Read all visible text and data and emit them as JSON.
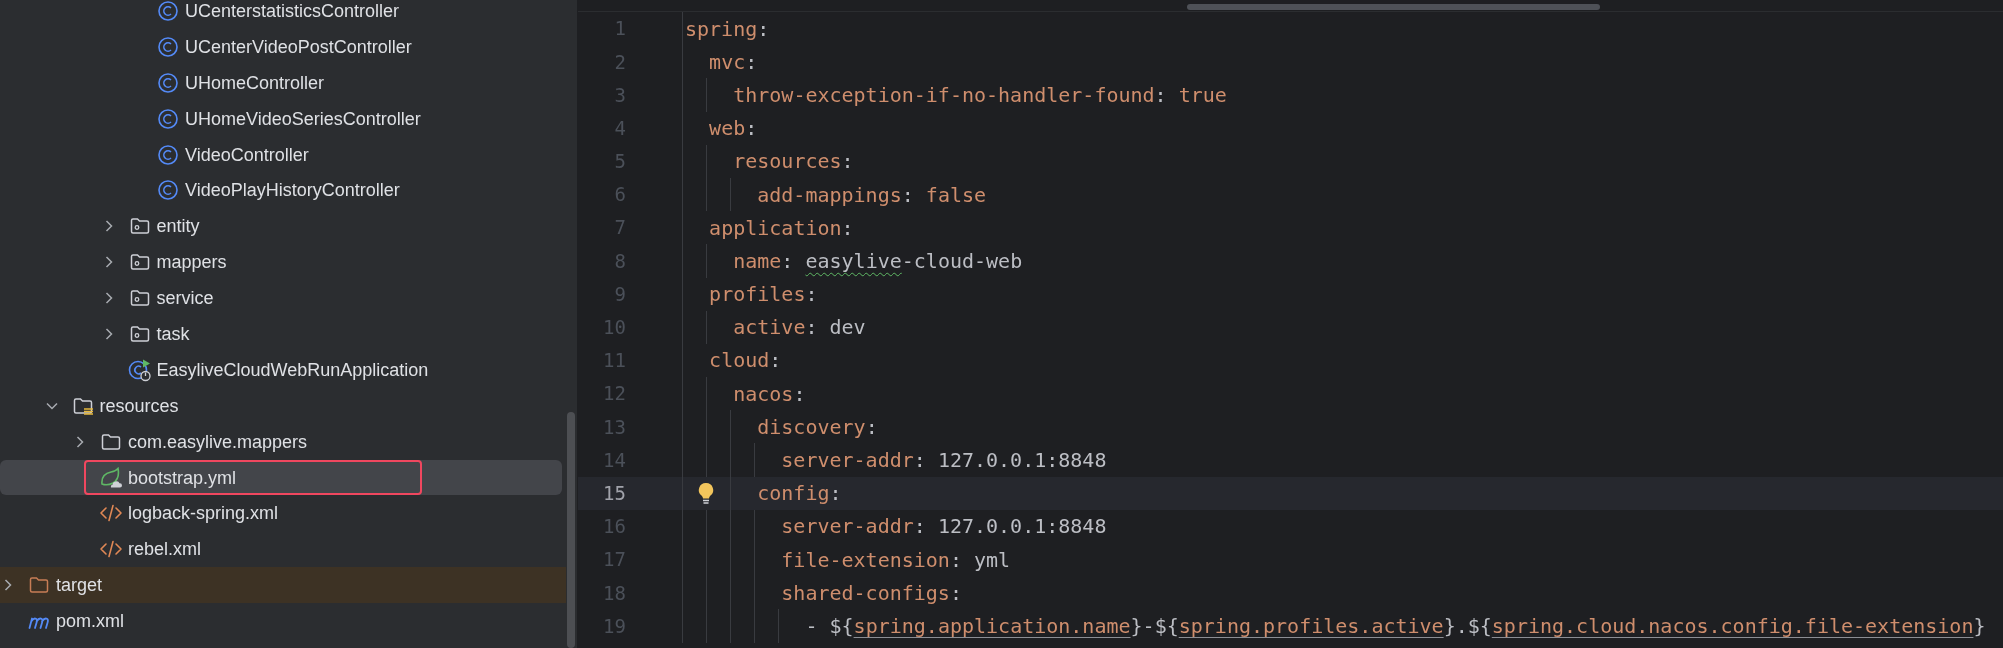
{
  "project_tree": [
    {
      "children": [
        {
          "children": [
            {
              "children": [
                {
                  "children": [
                    {
                      "children": [
                        {
                          "label": "UCenterstatisticsController",
                          "kind": "class",
                          "selected": false,
                          "outlined": false
                        },
                        {
                          "label": "UCenterVideoPostController",
                          "kind": "class",
                          "selected": false,
                          "outlined": false
                        },
                        {
                          "label": "UHomeController",
                          "kind": "class",
                          "selected": false,
                          "outlined": false
                        },
                        {
                          "label": "UHomeVideoSeriesController",
                          "kind": "class",
                          "selected": false,
                          "outlined": false
                        },
                        {
                          "label": "VideoController",
                          "kind": "class",
                          "selected": false,
                          "outlined": false
                        },
                        {
                          "label": "VideoPlayHistoryController",
                          "kind": "class",
                          "selected": false,
                          "outlined": false
                        }
                      ]
                    },
                    {
                      "label": "entity",
                      "kind": "package",
                      "expanded": false,
                      "selected": false,
                      "outlined": false
                    },
                    {
                      "label": "mappers",
                      "kind": "package",
                      "expanded": false,
                      "selected": false,
                      "outlined": false
                    },
                    {
                      "label": "service",
                      "kind": "package",
                      "expanded": false,
                      "selected": false,
                      "outlined": false
                    },
                    {
                      "label": "task",
                      "kind": "package",
                      "expanded": false,
                      "selected": false,
                      "outlined": false
                    },
                    {
                      "label": "EasyliveCloudWebRunApplication",
                      "kind": "run-class",
                      "selected": false,
                      "outlined": false
                    }
                  ]
                }
              ]
            },
            {
              "label": "resources",
              "kind": "resources-folder",
              "expanded": true,
              "selected": false,
              "outlined": false,
              "children": [
                {
                  "label": "com.easylive.mappers",
                  "kind": "folder",
                  "expanded": false,
                  "selected": false,
                  "outlined": false
                },
                {
                  "label": "bootstrap.yml",
                  "kind": "spring-config",
                  "selected": true,
                  "outlined": true
                },
                {
                  "label": "logback-spring.xml",
                  "kind": "xml",
                  "selected": false,
                  "outlined": false
                },
                {
                  "label": "rebel.xml",
                  "kind": "xml",
                  "selected": false,
                  "outlined": false
                }
              ]
            }
          ]
        }
      ]
    },
    {
      "label": "target",
      "kind": "excluded-folder",
      "expanded": false,
      "selected": false,
      "outlined": false
    },
    {
      "label": "pom.xml",
      "kind": "maven",
      "selected": false,
      "outlined": false
    }
  ],
  "editor": {
    "lines": [
      {
        "number": "1",
        "current": false,
        "tokens": [
          {
            "text": "spring",
            "kind": "key"
          },
          {
            "text": ":",
            "kind": "punct"
          }
        ]
      },
      {
        "number": "2",
        "current": false,
        "tokens": [
          {
            "text": "  mvc",
            "kind": "key"
          },
          {
            "text": ":",
            "kind": "punct"
          }
        ]
      },
      {
        "number": "3",
        "current": false,
        "tokens": [
          {
            "text": "    throw-exception-if-no-handler-found",
            "kind": "key"
          },
          {
            "text": ": ",
            "kind": "punct"
          },
          {
            "text": "true",
            "kind": "keyword"
          }
        ]
      },
      {
        "number": "4",
        "current": false,
        "tokens": [
          {
            "text": "  web",
            "kind": "key"
          },
          {
            "text": ":",
            "kind": "punct"
          }
        ]
      },
      {
        "number": "5",
        "current": false,
        "tokens": [
          {
            "text": "    resources",
            "kind": "key"
          },
          {
            "text": ":",
            "kind": "punct"
          }
        ]
      },
      {
        "number": "6",
        "current": false,
        "tokens": [
          {
            "text": "      add-mappings",
            "kind": "key"
          },
          {
            "text": ": ",
            "kind": "punct"
          },
          {
            "text": "false",
            "kind": "keyword"
          }
        ]
      },
      {
        "number": "7",
        "current": false,
        "tokens": [
          {
            "text": "  application",
            "kind": "key"
          },
          {
            "text": ":",
            "kind": "punct"
          }
        ]
      },
      {
        "number": "8",
        "current": false,
        "tokens": [
          {
            "text": "    name",
            "kind": "key"
          },
          {
            "text": ": ",
            "kind": "punct"
          },
          {
            "text": "easylive",
            "kind": "typo"
          },
          {
            "text": "-cloud-web",
            "kind": "value"
          }
        ]
      },
      {
        "number": "9",
        "current": false,
        "tokens": [
          {
            "text": "  profiles",
            "kind": "key"
          },
          {
            "text": ":",
            "kind": "punct"
          }
        ]
      },
      {
        "number": "10",
        "current": false,
        "tokens": [
          {
            "text": "    active",
            "kind": "key"
          },
          {
            "text": ": ",
            "kind": "punct"
          },
          {
            "text": "dev",
            "kind": "value"
          }
        ]
      },
      {
        "number": "11",
        "current": false,
        "tokens": [
          {
            "text": "  cloud",
            "kind": "key"
          },
          {
            "text": ":",
            "kind": "punct"
          }
        ]
      },
      {
        "number": "12",
        "current": false,
        "tokens": [
          {
            "text": "    nacos",
            "kind": "key"
          },
          {
            "text": ":",
            "kind": "punct"
          }
        ]
      },
      {
        "number": "13",
        "current": false,
        "tokens": [
          {
            "text": "      discovery",
            "kind": "key"
          },
          {
            "text": ":",
            "kind": "punct"
          }
        ]
      },
      {
        "number": "14",
        "current": false,
        "tokens": [
          {
            "text": "        server-addr",
            "kind": "key"
          },
          {
            "text": ": ",
            "kind": "punct"
          },
          {
            "text": "127.0.0.1:8848",
            "kind": "value"
          }
        ]
      },
      {
        "number": "15",
        "current": true,
        "tokens": [
          {
            "text": "      config",
            "kind": "key"
          },
          {
            "text": ":",
            "kind": "punct"
          }
        ]
      },
      {
        "number": "16",
        "current": false,
        "tokens": [
          {
            "text": "        server-addr",
            "kind": "key"
          },
          {
            "text": ": ",
            "kind": "punct"
          },
          {
            "text": "127.0.0.1:8848",
            "kind": "value"
          }
        ]
      },
      {
        "number": "17",
        "current": false,
        "tokens": [
          {
            "text": "        file-extension",
            "kind": "key"
          },
          {
            "text": ": ",
            "kind": "punct"
          },
          {
            "text": "yml",
            "kind": "value"
          }
        ]
      },
      {
        "number": "18",
        "current": false,
        "tokens": [
          {
            "text": "        shared-configs",
            "kind": "key"
          },
          {
            "text": ":",
            "kind": "punct"
          }
        ]
      },
      {
        "number": "19",
        "current": false,
        "tokens": [
          {
            "text": "          - ${",
            "kind": "punct"
          },
          {
            "text": "spring.application.name",
            "kind": "ref"
          },
          {
            "text": "}-${",
            "kind": "punct"
          },
          {
            "text": "spring.profiles.active",
            "kind": "ref"
          },
          {
            "text": "}.${",
            "kind": "punct"
          },
          {
            "text": "spring.cloud.nacos.config.file-extension",
            "kind": "ref"
          },
          {
            "text": "}",
            "kind": "punct"
          }
        ]
      }
    ]
  }
}
